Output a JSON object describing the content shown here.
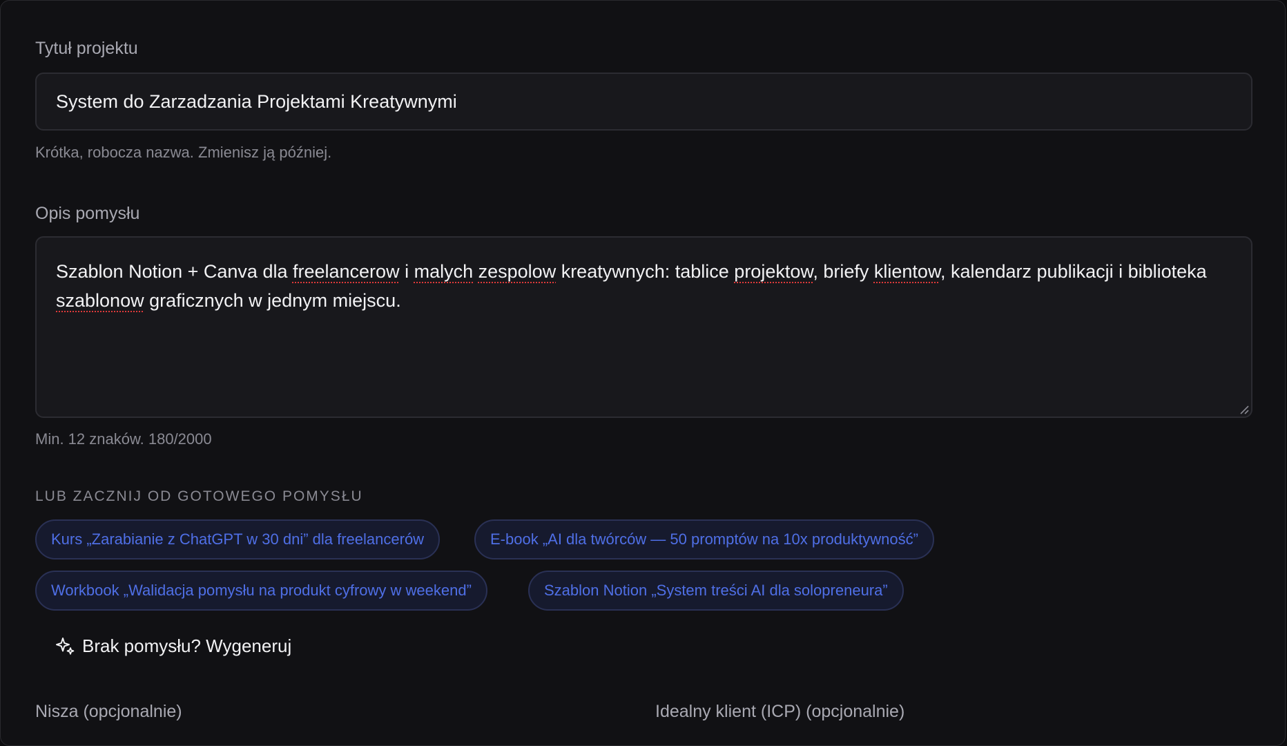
{
  "form": {
    "title_label": "Tytuł projektu",
    "title_value": "System do Zarzadzania Projektami Kreatywnymi",
    "title_hint": "Krótka, robocza nazwa. Zmienisz ją później.",
    "description_label": "Opis pomysłu",
    "description_segments": [
      {
        "text": "Szablon Notion + Canva dla ",
        "misspelled": false
      },
      {
        "text": "freelancerow",
        "misspelled": true
      },
      {
        "text": " i ",
        "misspelled": false
      },
      {
        "text": "malych",
        "misspelled": true
      },
      {
        "text": " ",
        "misspelled": false
      },
      {
        "text": "zespolow",
        "misspelled": true
      },
      {
        "text": " kreatywnych: tablice ",
        "misspelled": false
      },
      {
        "text": "projektow",
        "misspelled": true
      },
      {
        "text": ", briefy ",
        "misspelled": false
      },
      {
        "text": "klientow",
        "misspelled": true
      },
      {
        "text": ", kalendarz publikacji i biblioteka ",
        "misspelled": false
      },
      {
        "text": "szablonow",
        "misspelled": true
      },
      {
        "text": " graficznych w jednym miejscu.",
        "misspelled": false
      }
    ],
    "description_hint": "Min. 12 znaków. 180/2000",
    "ideas_caption": "LUB ZACZNIJ OD GOTOWEGO POMYSŁU",
    "idea_chips": [
      "Kurs „Zarabianie z ChatGPT w 30 dni” dla freelancerów",
      "E-book „AI dla twórców — 50 promptów na 10x produktywność”",
      "Workbook „Walidacja pomysłu na produkt cyfrowy w weekend”",
      "Szablon Notion „System treści AI dla solopreneura”"
    ],
    "generate_label": "Brak pomysłu? Wygeneruj",
    "generate_icon": "sparkles-icon",
    "niche_label": "Nisza (opcjonalnie)",
    "icp_label": "Idealny klient (ICP) (opcjonalnie)"
  },
  "colors": {
    "panel_bg": "#111114",
    "field_bg": "#18181c",
    "chip_text": "#4f6fe6",
    "chip_bg": "#161a2e",
    "spellcheck_underline": "#e03a3a"
  }
}
